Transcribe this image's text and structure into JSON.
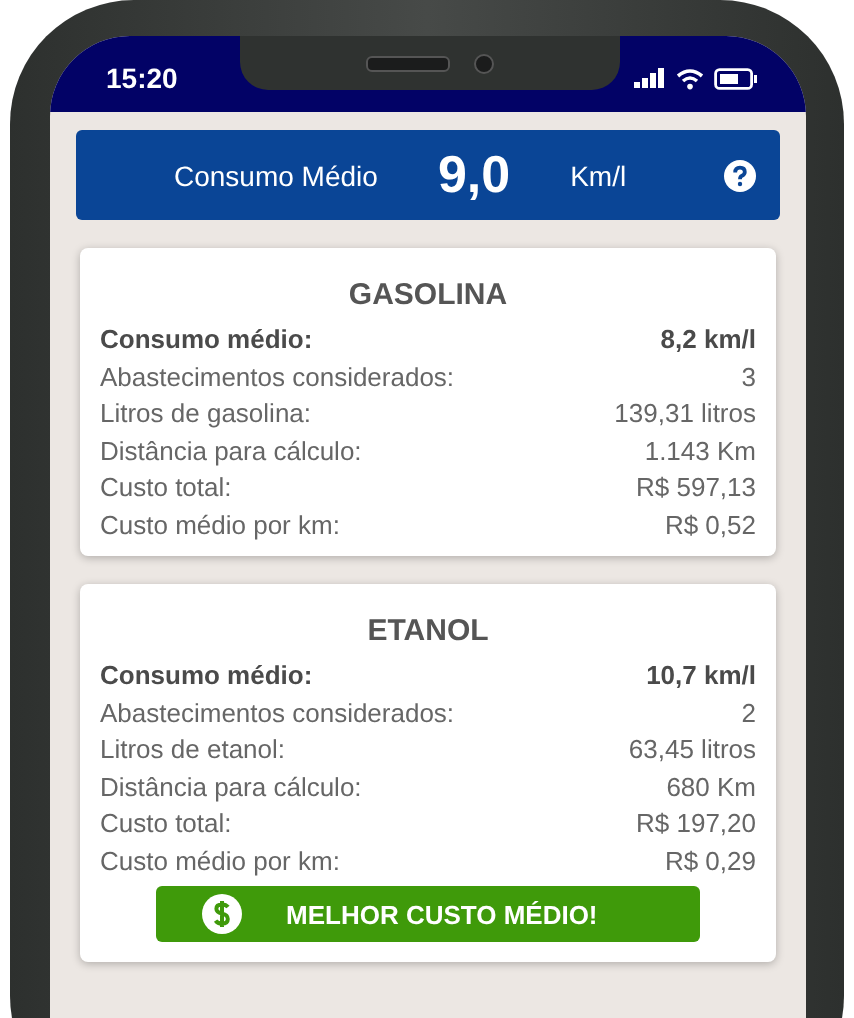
{
  "status_bar": {
    "time": "15:20"
  },
  "summary": {
    "label": "Consumo Médio",
    "value": "9,0",
    "unit": "Km/l"
  },
  "cards": [
    {
      "title": "GASOLINA",
      "rows": [
        {
          "kind": "main",
          "label": "Consumo médio:",
          "value": "8,2 km/l"
        },
        {
          "kind": "detail",
          "label": "Abastecimentos considerados:",
          "value": "3"
        },
        {
          "kind": "detail",
          "label": "Litros de gasolina:",
          "value": "139,31 litros"
        },
        {
          "kind": "detail",
          "label": "Distância para cálculo:",
          "value": "1.143 Km"
        },
        {
          "kind": "detail",
          "label": "Custo total:",
          "value": "R$ 597,13"
        },
        {
          "kind": "detail",
          "label": "Custo médio por km:",
          "value": "R$ 0,52"
        }
      ]
    },
    {
      "title": "ETANOL",
      "rows": [
        {
          "kind": "main",
          "label": "Consumo médio:",
          "value": "10,7 km/l"
        },
        {
          "kind": "detail",
          "label": "Abastecimentos considerados:",
          "value": "2"
        },
        {
          "kind": "detail",
          "label": "Litros de etanol:",
          "value": "63,45 litros"
        },
        {
          "kind": "detail",
          "label": "Distância para cálculo:",
          "value": "680 Km"
        },
        {
          "kind": "detail",
          "label": "Custo total:",
          "value": "R$ 197,20"
        },
        {
          "kind": "detail",
          "label": "Custo médio por km:",
          "value": "R$ 0,29"
        }
      ],
      "badge": {
        "label": "MELHOR CUSTO MÉDIO!"
      }
    }
  ]
}
